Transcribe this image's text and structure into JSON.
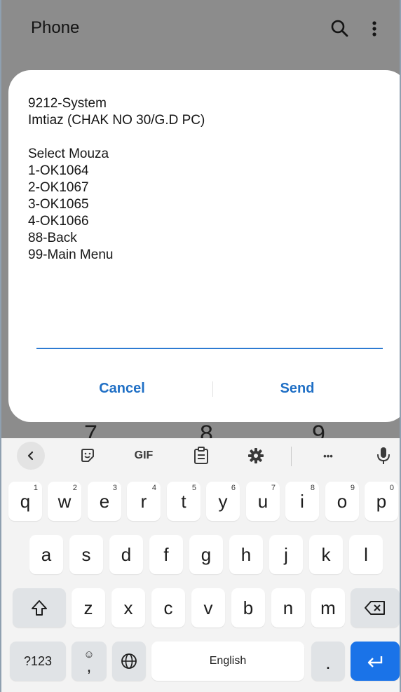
{
  "app": {
    "title": "Phone",
    "search_icon": "search-icon",
    "menu_icon": "more-vert-icon"
  },
  "dialpad_peek": [
    "7",
    "8",
    "9"
  ],
  "dialog": {
    "lines": [
      "9212-System",
      "Imtiaz (CHAK NO 30/G.D PC)",
      "",
      "Select Mouza",
      "1-OK1064",
      "2-OK1067",
      "3-OK1065",
      "4-OK1066",
      "88-Back",
      "99-Main Menu"
    ],
    "input_value": "",
    "cancel_label": "Cancel",
    "send_label": "Send",
    "accent_color": "#1f6fc5"
  },
  "keyboard": {
    "toolbar": {
      "back_icon": "chevron-left-icon",
      "sticker_icon": "sticker-icon",
      "gif_label": "GIF",
      "clipboard_icon": "clipboard-icon",
      "settings_icon": "gear-icon",
      "more_label": "•••",
      "mic_icon": "microphone-icon"
    },
    "row1": [
      {
        "key": "q",
        "hint": "1"
      },
      {
        "key": "w",
        "hint": "2"
      },
      {
        "key": "e",
        "hint": "3"
      },
      {
        "key": "r",
        "hint": "4"
      },
      {
        "key": "t",
        "hint": "5"
      },
      {
        "key": "y",
        "hint": "6"
      },
      {
        "key": "u",
        "hint": "7"
      },
      {
        "key": "i",
        "hint": "8"
      },
      {
        "key": "o",
        "hint": "9"
      },
      {
        "key": "p",
        "hint": "0"
      }
    ],
    "row2": [
      "a",
      "s",
      "d",
      "f",
      "g",
      "h",
      "j",
      "k",
      "l"
    ],
    "row3": [
      "z",
      "x",
      "c",
      "v",
      "b",
      "n",
      "m"
    ],
    "shift_icon": "shift-icon",
    "backspace_icon": "backspace-icon",
    "symbols_label": "?123",
    "emoji_comma": {
      "top": "☺",
      "bottom": ","
    },
    "globe_icon": "globe-icon",
    "space_label": "English",
    "period_label": ".",
    "enter_icon": "enter-icon",
    "enter_color": "#1a73e8"
  }
}
